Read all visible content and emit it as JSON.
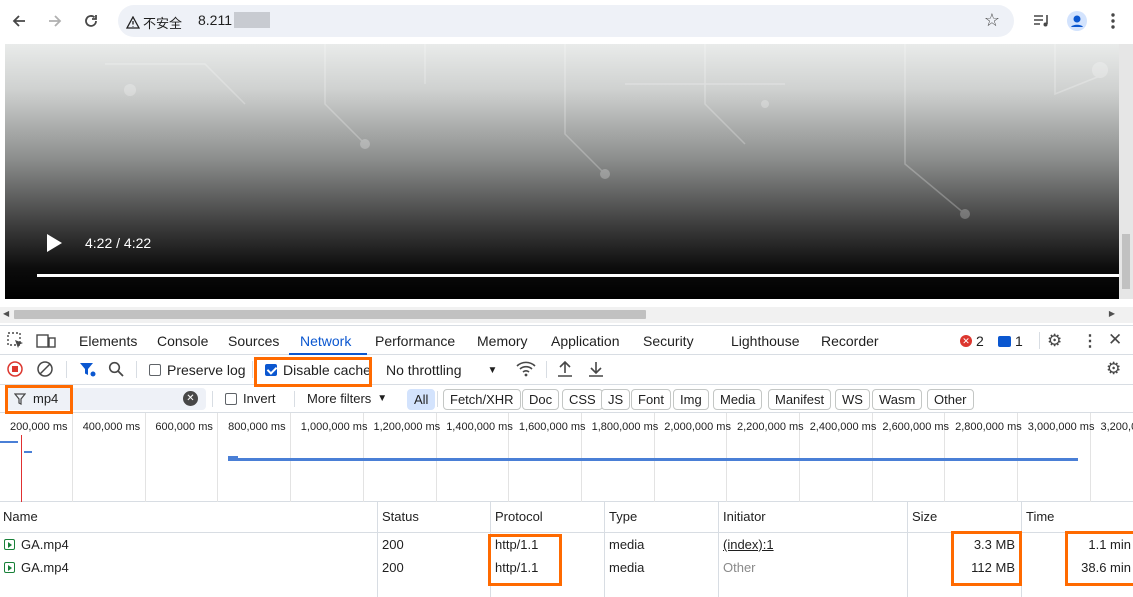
{
  "browser": {
    "security_label": "不安全",
    "url": "8.211"
  },
  "video": {
    "time": "4:22 / 4:22",
    "progress": 1.0
  },
  "devtools": {
    "tabs": [
      "Elements",
      "Console",
      "Sources",
      "Network",
      "Performance",
      "Memory",
      "Application",
      "Security",
      "Lighthouse",
      "Recorder"
    ],
    "active_tab": "Network",
    "error_count": "2",
    "message_count": "1"
  },
  "network_toolbar": {
    "preserve_log": "Preserve log",
    "disable_cache": "Disable cache",
    "throttling": "No throttling"
  },
  "filter": {
    "value": "mp4",
    "invert": "Invert",
    "more_filters": "More filters",
    "chips": [
      "All",
      "Fetch/XHR",
      "Doc",
      "CSS",
      "JS",
      "Font",
      "Img",
      "Media",
      "Manifest",
      "WS",
      "Wasm",
      "Other"
    ]
  },
  "timeline": {
    "ticks": [
      "200,000 ms",
      "400,000 ms",
      "600,000 ms",
      "800,000 ms",
      "1,000,000 ms",
      "1,200,000 ms",
      "1,400,000 ms",
      "1,600,000 ms",
      "1,800,000 ms",
      "2,000,000 ms",
      "2,200,000 ms",
      "2,400,000 ms",
      "2,600,000 ms",
      "2,800,000 ms",
      "3,000,000 ms",
      "3,200,0"
    ]
  },
  "table": {
    "columns": [
      "Name",
      "Status",
      "Protocol",
      "Type",
      "Initiator",
      "Size",
      "Time"
    ],
    "rows": [
      {
        "name": "GA.mp4",
        "status": "200",
        "protocol": "http/1.1",
        "type": "media",
        "initiator": "(index):1",
        "size": "3.3 MB",
        "time": "1.1 min"
      },
      {
        "name": "GA.mp4",
        "status": "200",
        "protocol": "http/1.1",
        "type": "media",
        "initiator": "Other",
        "size": "112 MB",
        "time": "38.6 min"
      }
    ]
  },
  "colors": {
    "accent": "#0b57d0",
    "highlight": "#ff6a00",
    "error": "#dc362e"
  }
}
